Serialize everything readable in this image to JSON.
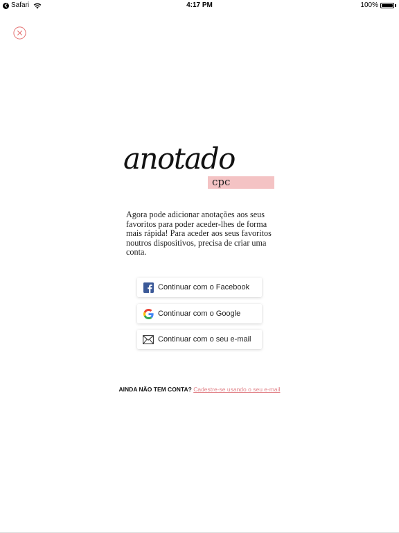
{
  "status_bar": {
    "back_app": "Safari",
    "time": "4:17 PM",
    "battery_percent_text": "100%",
    "battery_level": 1.0
  },
  "close": {
    "icon": "close-circle-icon",
    "color": "#e57373"
  },
  "logo": {
    "word": "anotado",
    "sub": "cpc",
    "highlight_color": "#f4c3c4"
  },
  "description": "Agora pode adicionar anotações aos seus favoritos para poder aceder-lhes de forma mais rápida! Para aceder aos seus favoritos noutros dispositivos, precisa de criar uma conta.",
  "login_options": {
    "facebook": {
      "label": "Continuar com o Facebook",
      "icon": "facebook-icon",
      "color": "#3b5998"
    },
    "google": {
      "label": "Continuar com o Google",
      "icon": "google-icon"
    },
    "email": {
      "label": "Continuar com o seu e-mail",
      "icon": "envelope-icon"
    }
  },
  "signup": {
    "prompt": "AINDA NÃO TEM CONTA?",
    "link": "Cadestre-se usando o seu e-mail",
    "link_color": "#e2848a"
  }
}
